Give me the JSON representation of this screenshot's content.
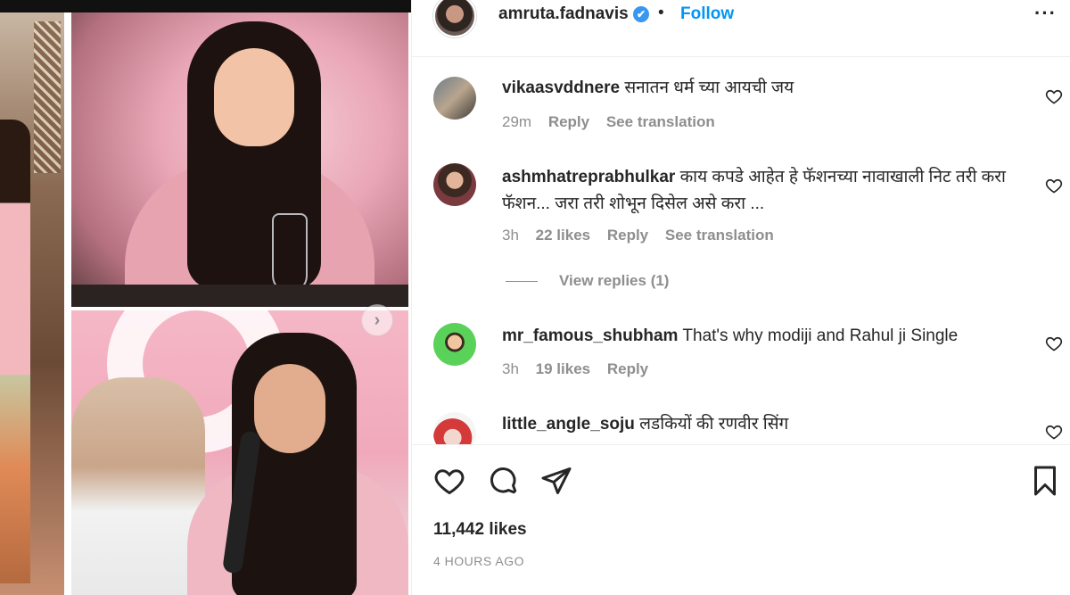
{
  "post": {
    "username": "amruta.fadnavis",
    "verified_icon": "✔",
    "separator": "•",
    "follow_label": "Follow",
    "more_label": "···",
    "likes": "11,442 likes",
    "time": "4 HOURS AGO",
    "carousel_next_glyph": "›"
  },
  "comments": [
    {
      "username": "vikaasvddnere",
      "text": "सनातन धर्म च्या आयची जय",
      "age": "29m",
      "likes": "",
      "reply": "Reply",
      "translate": "See translation"
    },
    {
      "username": "ashmhatreprabhulkar",
      "text": "काय कपडे आहेत हे फॅशनच्या नावाखाली निट तरी करा फॅशन... जरा तरी शोभून दिसेल असे करा ...",
      "age": "3h",
      "likes": "22 likes",
      "reply": "Reply",
      "translate": "See translation"
    },
    {
      "username": "mr_famous_shubham",
      "text": "That's why modiji and Rahul ji Single",
      "age": "3h",
      "likes": "19 likes",
      "reply": "Reply",
      "translate": ""
    },
    {
      "username": "little_angle_soju",
      "text": "लडकियों की रणवीर सिंग",
      "age": "",
      "likes": "",
      "reply": "",
      "translate": ""
    }
  ],
  "view_replies": "View replies (1)",
  "icons": {
    "like": "heart-icon",
    "comment": "comment-icon",
    "share": "share-icon",
    "save": "bookmark-icon",
    "verified": "verified-badge-icon",
    "more": "more-options-icon"
  },
  "colors": {
    "link": "#0095f6",
    "verified": "#3897f0",
    "muted": "#8e8e8e",
    "text": "#262626"
  }
}
